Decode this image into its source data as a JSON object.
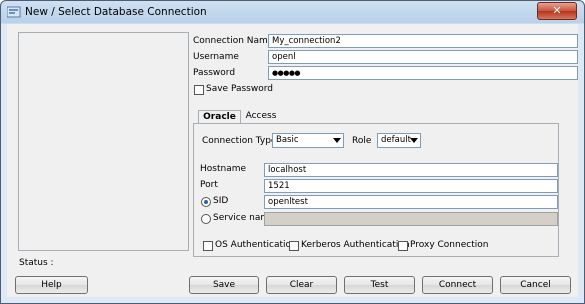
{
  "window": {
    "title": "New / Select Database Connection",
    "close_glyph": "✕"
  },
  "form": {
    "connection_name": {
      "label": "Connection Name",
      "value": "My_connection2"
    },
    "username": {
      "label": "Username",
      "value": "openl"
    },
    "password": {
      "label": "Password",
      "value": "●●●●●"
    },
    "save_password": {
      "label": "Save Password",
      "checked": false
    }
  },
  "tabs": [
    {
      "label": "Oracle",
      "active": true
    },
    {
      "label": "Access",
      "active": false
    }
  ],
  "oracle": {
    "connection_type": {
      "label": "Connection Type",
      "value": "Basic"
    },
    "role": {
      "label": "Role",
      "value": "default"
    },
    "hostname": {
      "label": "Hostname",
      "value": "localhost"
    },
    "port": {
      "label": "Port",
      "value": "1521"
    },
    "sid": {
      "label": "SID",
      "value": "openltest",
      "selected": true
    },
    "service_name": {
      "label": "Service name",
      "value": "",
      "selected": false
    },
    "os_auth": {
      "label": "OS Authentication",
      "checked": false
    },
    "kerberos_auth": {
      "label": "Kerberos Authentication",
      "checked": false
    },
    "proxy_connection": {
      "label": "Proxy Connection",
      "checked": false
    }
  },
  "status": {
    "label": "Status :"
  },
  "buttons": {
    "help": "Help",
    "save": "Save",
    "clear": "Clear",
    "test": "Test",
    "connect": "Connect",
    "cancel": "Cancel"
  }
}
